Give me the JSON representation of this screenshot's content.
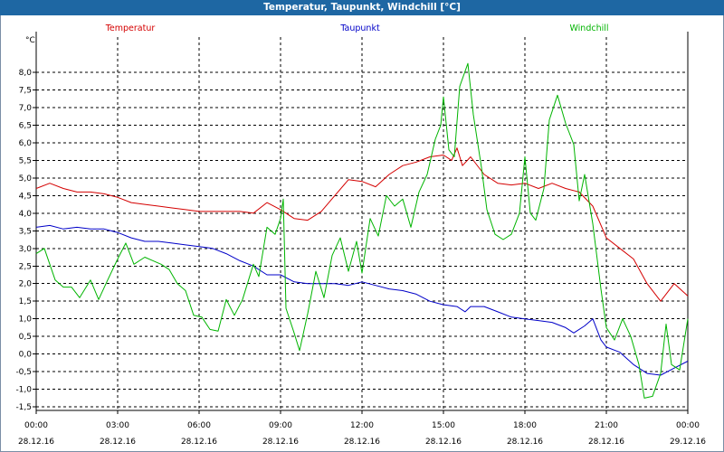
{
  "window": {
    "title": "Temperatur, Taupunkt, Windchill [°C]"
  },
  "chart_data": {
    "type": "line",
    "unit_label": "°C",
    "ylim": [
      -1.6,
      9.0
    ],
    "y_ticks": [
      "-1,5",
      "-1,0",
      "-0,5",
      "0,0",
      "0,5",
      "1,0",
      "1,5",
      "2,0",
      "2,5",
      "3,0",
      "3,5",
      "4,0",
      "4,5",
      "5,0",
      "5,5",
      "6,0",
      "6,5",
      "7,0",
      "7,5",
      "8,0"
    ],
    "x_range_hours": [
      0,
      24
    ],
    "x_ticks": [
      {
        "time": "00:00",
        "date": "28.12.16"
      },
      {
        "time": "03:00",
        "date": "28.12.16"
      },
      {
        "time": "06:00",
        "date": "28.12.16"
      },
      {
        "time": "09:00",
        "date": "28.12.16"
      },
      {
        "time": "12:00",
        "date": "28.12.16"
      },
      {
        "time": "15:00",
        "date": "28.12.16"
      },
      {
        "time": "18:00",
        "date": "28.12.16"
      },
      {
        "time": "21:00",
        "date": "28.12.16"
      },
      {
        "time": "00:00",
        "date": "29.12.16"
      }
    ],
    "grid": true,
    "legend_placement": "top",
    "series": [
      {
        "name": "Temperatur",
        "color": "#d40000",
        "points": [
          [
            0,
            4.7
          ],
          [
            0.5,
            4.85
          ],
          [
            1,
            4.7
          ],
          [
            1.5,
            4.6
          ],
          [
            2,
            4.6
          ],
          [
            2.5,
            4.55
          ],
          [
            3,
            4.45
          ],
          [
            3.5,
            4.3
          ],
          [
            4,
            4.25
          ],
          [
            4.5,
            4.2
          ],
          [
            5,
            4.15
          ],
          [
            5.5,
            4.1
          ],
          [
            6,
            4.05
          ],
          [
            6.5,
            4.05
          ],
          [
            7,
            4.05
          ],
          [
            7.5,
            4.05
          ],
          [
            8,
            4.0
          ],
          [
            8.5,
            4.3
          ],
          [
            9,
            4.1
          ],
          [
            9.5,
            3.85
          ],
          [
            10,
            3.8
          ],
          [
            10.5,
            4.05
          ],
          [
            11,
            4.5
          ],
          [
            11.5,
            4.95
          ],
          [
            12,
            4.9
          ],
          [
            12.5,
            4.75
          ],
          [
            13,
            5.1
          ],
          [
            13.5,
            5.35
          ],
          [
            14,
            5.45
          ],
          [
            14.5,
            5.6
          ],
          [
            15,
            5.65
          ],
          [
            15.3,
            5.5
          ],
          [
            15.5,
            5.85
          ],
          [
            15.7,
            5.35
          ],
          [
            16,
            5.6
          ],
          [
            16.5,
            5.1
          ],
          [
            17,
            4.85
          ],
          [
            17.5,
            4.8
          ],
          [
            18,
            4.85
          ],
          [
            18.5,
            4.7
          ],
          [
            19,
            4.85
          ],
          [
            19.5,
            4.7
          ],
          [
            20,
            4.6
          ],
          [
            20.5,
            4.2
          ],
          [
            21,
            3.3
          ],
          [
            21.5,
            3.0
          ],
          [
            22,
            2.7
          ],
          [
            22.5,
            2.0
          ],
          [
            23,
            1.5
          ],
          [
            23.5,
            2.0
          ],
          [
            24,
            1.65
          ]
        ]
      },
      {
        "name": "Taupunkt",
        "color": "#0000c8",
        "points": [
          [
            0,
            3.6
          ],
          [
            0.5,
            3.65
          ],
          [
            1,
            3.55
          ],
          [
            1.5,
            3.6
          ],
          [
            2,
            3.55
          ],
          [
            2.5,
            3.55
          ],
          [
            3,
            3.45
          ],
          [
            3.5,
            3.3
          ],
          [
            4,
            3.2
          ],
          [
            4.5,
            3.2
          ],
          [
            5,
            3.15
          ],
          [
            5.5,
            3.1
          ],
          [
            6,
            3.05
          ],
          [
            6.5,
            3.0
          ],
          [
            7,
            2.85
          ],
          [
            7.5,
            2.65
          ],
          [
            8,
            2.5
          ],
          [
            8.5,
            2.25
          ],
          [
            9,
            2.25
          ],
          [
            9.5,
            2.05
          ],
          [
            10,
            2.0
          ],
          [
            10.5,
            2.0
          ],
          [
            11,
            2.0
          ],
          [
            11.5,
            1.95
          ],
          [
            12,
            2.05
          ],
          [
            12.5,
            1.95
          ],
          [
            13,
            1.85
          ],
          [
            13.5,
            1.8
          ],
          [
            14,
            1.7
          ],
          [
            14.5,
            1.5
          ],
          [
            15,
            1.4
          ],
          [
            15.5,
            1.35
          ],
          [
            15.8,
            1.2
          ],
          [
            16,
            1.35
          ],
          [
            16.5,
            1.35
          ],
          [
            17,
            1.2
          ],
          [
            17.5,
            1.05
          ],
          [
            18,
            1.0
          ],
          [
            18.5,
            0.95
          ],
          [
            19,
            0.9
          ],
          [
            19.5,
            0.75
          ],
          [
            19.8,
            0.6
          ],
          [
            20.2,
            0.8
          ],
          [
            20.5,
            1.0
          ],
          [
            20.8,
            0.4
          ],
          [
            21,
            0.2
          ],
          [
            21.5,
            0.05
          ],
          [
            22,
            -0.3
          ],
          [
            22.5,
            -0.55
          ],
          [
            23,
            -0.6
          ],
          [
            23.5,
            -0.4
          ],
          [
            24,
            -0.2
          ]
        ]
      },
      {
        "name": "Windchill",
        "color": "#00b400",
        "points": [
          [
            0,
            2.85
          ],
          [
            0.3,
            3.0
          ],
          [
            0.7,
            2.1
          ],
          [
            1,
            1.9
          ],
          [
            1.3,
            1.9
          ],
          [
            1.6,
            1.6
          ],
          [
            2,
            2.1
          ],
          [
            2.3,
            1.55
          ],
          [
            2.6,
            2.05
          ],
          [
            3,
            2.7
          ],
          [
            3.3,
            3.15
          ],
          [
            3.6,
            2.55
          ],
          [
            4,
            2.75
          ],
          [
            4.3,
            2.65
          ],
          [
            4.6,
            2.55
          ],
          [
            4.9,
            2.4
          ],
          [
            5.2,
            2.0
          ],
          [
            5.5,
            1.8
          ],
          [
            5.8,
            1.1
          ],
          [
            6.1,
            1.05
          ],
          [
            6.4,
            0.7
          ],
          [
            6.7,
            0.65
          ],
          [
            7,
            1.55
          ],
          [
            7.3,
            1.1
          ],
          [
            7.6,
            1.55
          ],
          [
            8,
            2.55
          ],
          [
            8.2,
            2.2
          ],
          [
            8.5,
            3.6
          ],
          [
            8.8,
            3.4
          ],
          [
            9,
            3.85
          ],
          [
            9.1,
            4.4
          ],
          [
            9.2,
            1.3
          ],
          [
            9.5,
            0.6
          ],
          [
            9.7,
            0.1
          ],
          [
            10,
            1.15
          ],
          [
            10.3,
            2.35
          ],
          [
            10.6,
            1.6
          ],
          [
            10.9,
            2.8
          ],
          [
            11.2,
            3.3
          ],
          [
            11.5,
            2.35
          ],
          [
            11.8,
            3.2
          ],
          [
            12,
            2.3
          ],
          [
            12.3,
            3.85
          ],
          [
            12.6,
            3.35
          ],
          [
            12.9,
            4.5
          ],
          [
            13.2,
            4.2
          ],
          [
            13.5,
            4.4
          ],
          [
            13.8,
            3.6
          ],
          [
            14.1,
            4.6
          ],
          [
            14.4,
            5.1
          ],
          [
            14.7,
            6.1
          ],
          [
            14.9,
            6.5
          ],
          [
            15,
            7.3
          ],
          [
            15.2,
            5.8
          ],
          [
            15.4,
            5.6
          ],
          [
            15.6,
            7.6
          ],
          [
            15.9,
            8.25
          ],
          [
            16.1,
            6.8
          ],
          [
            16.4,
            5.3
          ],
          [
            16.6,
            4.1
          ],
          [
            16.9,
            3.4
          ],
          [
            17.2,
            3.25
          ],
          [
            17.5,
            3.4
          ],
          [
            17.8,
            4.0
          ],
          [
            18,
            5.6
          ],
          [
            18.2,
            4.0
          ],
          [
            18.4,
            3.8
          ],
          [
            18.7,
            4.7
          ],
          [
            18.9,
            6.65
          ],
          [
            19.2,
            7.35
          ],
          [
            19.5,
            6.55
          ],
          [
            19.8,
            5.95
          ],
          [
            20,
            4.35
          ],
          [
            20.2,
            5.1
          ],
          [
            20.5,
            3.7
          ],
          [
            20.8,
            1.85
          ],
          [
            21,
            0.75
          ],
          [
            21.3,
            0.4
          ],
          [
            21.6,
            1.0
          ],
          [
            21.9,
            0.5
          ],
          [
            22.2,
            -0.3
          ],
          [
            22.4,
            -1.25
          ],
          [
            22.7,
            -1.2
          ],
          [
            23,
            -0.55
          ],
          [
            23.2,
            0.85
          ],
          [
            23.4,
            -0.3
          ],
          [
            23.7,
            -0.45
          ],
          [
            24,
            1.0
          ]
        ]
      }
    ]
  }
}
